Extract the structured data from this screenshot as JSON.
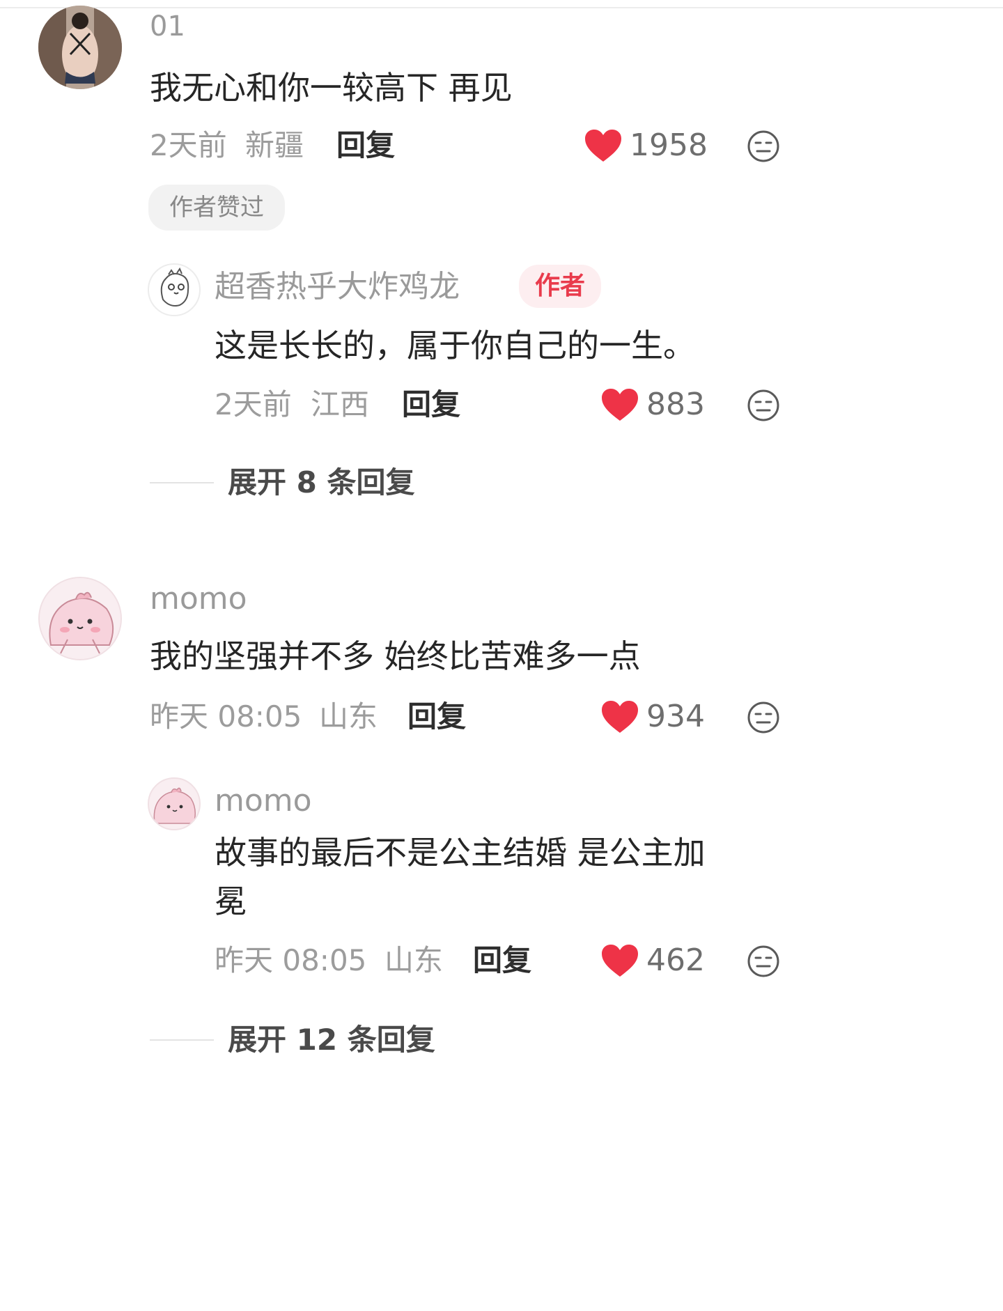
{
  "colors": {
    "like_heart": "#ee3347",
    "author_badge_text": "#e93b4c",
    "author_badge_bg": "#fdeef0"
  },
  "comments": [
    {
      "username": "01",
      "text": "我无心和你一较高下 再见",
      "time": "2天前",
      "location": "新疆",
      "reply_label": "回复",
      "likes": "1958",
      "badge": "作者赞过",
      "replies": [
        {
          "username": "超香热乎大炸鸡龙",
          "author_tag": "作者",
          "text": "这是长长的，属于你自己的一生。",
          "time": "2天前",
          "location": "江西",
          "reply_label": "回复",
          "likes": "883"
        }
      ],
      "expand_label": "展开 8 条回复"
    },
    {
      "username": "momo",
      "text": "我的坚强并不多 始终比苦难多一点",
      "time": "昨天 08:05",
      "location": "山东",
      "reply_label": "回复",
      "likes": "934",
      "replies": [
        {
          "username": "momo",
          "text_line1": "故事的最后不是公主结婚 是公主加",
          "text_line2": "冕",
          "time": "昨天 08:05",
          "location": "山东",
          "reply_label": "回复",
          "likes": "462"
        }
      ],
      "expand_label": "展开 12 条回复"
    }
  ],
  "icons": {
    "like": "heart-icon",
    "dislike": "neutral-face-icon",
    "avatar1": "photo-avatar",
    "avatar2": "cartoon-dino-avatar",
    "avatar3": "pink-blob-avatar"
  }
}
